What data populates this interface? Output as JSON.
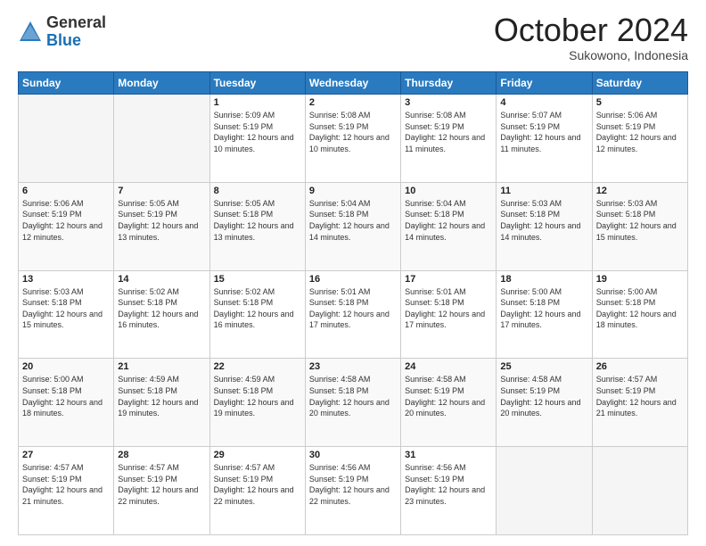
{
  "header": {
    "logo": {
      "general": "General",
      "blue": "Blue"
    },
    "title": "October 2024",
    "location": "Sukowono, Indonesia"
  },
  "weekdays": [
    "Sunday",
    "Monday",
    "Tuesday",
    "Wednesday",
    "Thursday",
    "Friday",
    "Saturday"
  ],
  "weeks": [
    [
      {
        "day": "",
        "info": ""
      },
      {
        "day": "",
        "info": ""
      },
      {
        "day": "1",
        "info": "Sunrise: 5:09 AM\nSunset: 5:19 PM\nDaylight: 12 hours and 10 minutes."
      },
      {
        "day": "2",
        "info": "Sunrise: 5:08 AM\nSunset: 5:19 PM\nDaylight: 12 hours and 10 minutes."
      },
      {
        "day": "3",
        "info": "Sunrise: 5:08 AM\nSunset: 5:19 PM\nDaylight: 12 hours and 11 minutes."
      },
      {
        "day": "4",
        "info": "Sunrise: 5:07 AM\nSunset: 5:19 PM\nDaylight: 12 hours and 11 minutes."
      },
      {
        "day": "5",
        "info": "Sunrise: 5:06 AM\nSunset: 5:19 PM\nDaylight: 12 hours and 12 minutes."
      }
    ],
    [
      {
        "day": "6",
        "info": "Sunrise: 5:06 AM\nSunset: 5:19 PM\nDaylight: 12 hours and 12 minutes."
      },
      {
        "day": "7",
        "info": "Sunrise: 5:05 AM\nSunset: 5:19 PM\nDaylight: 12 hours and 13 minutes."
      },
      {
        "day": "8",
        "info": "Sunrise: 5:05 AM\nSunset: 5:18 PM\nDaylight: 12 hours and 13 minutes."
      },
      {
        "day": "9",
        "info": "Sunrise: 5:04 AM\nSunset: 5:18 PM\nDaylight: 12 hours and 14 minutes."
      },
      {
        "day": "10",
        "info": "Sunrise: 5:04 AM\nSunset: 5:18 PM\nDaylight: 12 hours and 14 minutes."
      },
      {
        "day": "11",
        "info": "Sunrise: 5:03 AM\nSunset: 5:18 PM\nDaylight: 12 hours and 14 minutes."
      },
      {
        "day": "12",
        "info": "Sunrise: 5:03 AM\nSunset: 5:18 PM\nDaylight: 12 hours and 15 minutes."
      }
    ],
    [
      {
        "day": "13",
        "info": "Sunrise: 5:03 AM\nSunset: 5:18 PM\nDaylight: 12 hours and 15 minutes."
      },
      {
        "day": "14",
        "info": "Sunrise: 5:02 AM\nSunset: 5:18 PM\nDaylight: 12 hours and 16 minutes."
      },
      {
        "day": "15",
        "info": "Sunrise: 5:02 AM\nSunset: 5:18 PM\nDaylight: 12 hours and 16 minutes."
      },
      {
        "day": "16",
        "info": "Sunrise: 5:01 AM\nSunset: 5:18 PM\nDaylight: 12 hours and 17 minutes."
      },
      {
        "day": "17",
        "info": "Sunrise: 5:01 AM\nSunset: 5:18 PM\nDaylight: 12 hours and 17 minutes."
      },
      {
        "day": "18",
        "info": "Sunrise: 5:00 AM\nSunset: 5:18 PM\nDaylight: 12 hours and 17 minutes."
      },
      {
        "day": "19",
        "info": "Sunrise: 5:00 AM\nSunset: 5:18 PM\nDaylight: 12 hours and 18 minutes."
      }
    ],
    [
      {
        "day": "20",
        "info": "Sunrise: 5:00 AM\nSunset: 5:18 PM\nDaylight: 12 hours and 18 minutes."
      },
      {
        "day": "21",
        "info": "Sunrise: 4:59 AM\nSunset: 5:18 PM\nDaylight: 12 hours and 19 minutes."
      },
      {
        "day": "22",
        "info": "Sunrise: 4:59 AM\nSunset: 5:18 PM\nDaylight: 12 hours and 19 minutes."
      },
      {
        "day": "23",
        "info": "Sunrise: 4:58 AM\nSunset: 5:18 PM\nDaylight: 12 hours and 20 minutes."
      },
      {
        "day": "24",
        "info": "Sunrise: 4:58 AM\nSunset: 5:19 PM\nDaylight: 12 hours and 20 minutes."
      },
      {
        "day": "25",
        "info": "Sunrise: 4:58 AM\nSunset: 5:19 PM\nDaylight: 12 hours and 20 minutes."
      },
      {
        "day": "26",
        "info": "Sunrise: 4:57 AM\nSunset: 5:19 PM\nDaylight: 12 hours and 21 minutes."
      }
    ],
    [
      {
        "day": "27",
        "info": "Sunrise: 4:57 AM\nSunset: 5:19 PM\nDaylight: 12 hours and 21 minutes."
      },
      {
        "day": "28",
        "info": "Sunrise: 4:57 AM\nSunset: 5:19 PM\nDaylight: 12 hours and 22 minutes."
      },
      {
        "day": "29",
        "info": "Sunrise: 4:57 AM\nSunset: 5:19 PM\nDaylight: 12 hours and 22 minutes."
      },
      {
        "day": "30",
        "info": "Sunrise: 4:56 AM\nSunset: 5:19 PM\nDaylight: 12 hours and 22 minutes."
      },
      {
        "day": "31",
        "info": "Sunrise: 4:56 AM\nSunset: 5:19 PM\nDaylight: 12 hours and 23 minutes."
      },
      {
        "day": "",
        "info": ""
      },
      {
        "day": "",
        "info": ""
      }
    ]
  ]
}
